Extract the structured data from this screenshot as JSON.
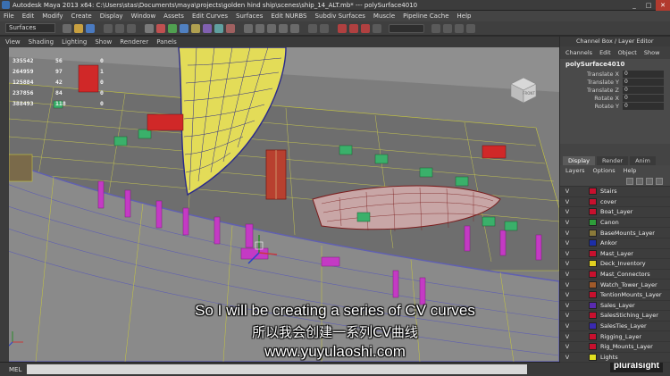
{
  "window": {
    "title": "Autodesk Maya 2013 x64: C:\\Users\\stas\\Documents\\maya\\projects\\golden hind ship\\scenes\\ship_14_ALT.mb* --- polySurface4010",
    "controls": [
      "_",
      "□",
      "✕"
    ]
  },
  "menubar": [
    "File",
    "Edit",
    "Modify",
    "Create",
    "Display",
    "Window",
    "Assets",
    "Edit Curves",
    "Surfaces",
    "Edit NURBS",
    "Subdiv Surfaces",
    "Muscle",
    "Pipeline Cache",
    "Help"
  ],
  "statusline": {
    "menu_set": "Surfaces"
  },
  "panel_menu": [
    "View",
    "Shading",
    "Lighting",
    "Show",
    "Renderer",
    "Panels"
  ],
  "heads_up": [
    [
      "335542",
      "56",
      "0"
    ],
    [
      "264959",
      "97",
      "1"
    ],
    [
      "125884",
      "42",
      "0"
    ],
    [
      "237856",
      "84",
      "0"
    ],
    [
      "388493",
      "118",
      "0"
    ]
  ],
  "viewcube": {
    "label": "FRONT"
  },
  "subtitles": {
    "english": "So I will be creating a series of CV curves",
    "chinese": "所以我会创建一系列CV曲线",
    "url": "www.yuyulaoshi.com"
  },
  "command_line": {
    "label": "MEL"
  },
  "brand": "pluralsight",
  "channel_box": {
    "header": "Channel Box / Layer Editor",
    "menu": [
      "Channels",
      "Edit",
      "Object",
      "Show"
    ],
    "node": "polySurface4010",
    "attributes": [
      {
        "label": "Translate X",
        "value": "0"
      },
      {
        "label": "Translate Y",
        "value": "0"
      },
      {
        "label": "Translate Z",
        "value": "0"
      },
      {
        "label": "Rotate X",
        "value": "0"
      },
      {
        "label": "Rotate Y",
        "value": "0"
      }
    ]
  },
  "layer_editor": {
    "tabs": [
      "Display",
      "Render",
      "Anim"
    ],
    "menu": [
      "Layers",
      "Options",
      "Help"
    ],
    "layers": [
      {
        "v": "V",
        "name": "Stairs",
        "color": "#c8102e"
      },
      {
        "v": "V",
        "name": "cover",
        "color": "#c8102e"
      },
      {
        "v": "V",
        "name": "Boat_Layer",
        "color": "#c8102e"
      },
      {
        "v": "V",
        "name": "Canon",
        "color": "#2e9e3a"
      },
      {
        "v": "V",
        "name": "BaseMounts_Layer",
        "color": "#8a7a3a"
      },
      {
        "v": "V",
        "name": "Ankor",
        "color": "#1c2ea8"
      },
      {
        "v": "V",
        "name": "Mast_Layer",
        "color": "#c8102e"
      },
      {
        "v": "V",
        "name": "Deck_Inventory",
        "color": "#e0d020"
      },
      {
        "v": "V",
        "name": "Mast_Connectors",
        "color": "#c8102e"
      },
      {
        "v": "V",
        "name": "Watch_Tower_Layer",
        "color": "#a05a2a"
      },
      {
        "v": "V",
        "name": "TentionMounts_Layer",
        "color": "#c8102e"
      },
      {
        "v": "V",
        "name": "Sales_Layer",
        "color": "#5a2ab0"
      },
      {
        "v": "V",
        "name": "SalesStiching_Layer",
        "color": "#c8102e"
      },
      {
        "v": "V",
        "name": "SalesTies_Layer",
        "color": "#3a2ab0"
      },
      {
        "v": "V",
        "name": "Rigging_Layer",
        "color": "#c8102e"
      },
      {
        "v": "V",
        "name": "Rig_Mounts_Layer",
        "color": "#c8102e"
      },
      {
        "v": "V",
        "name": "Lights",
        "color": "#e0e020"
      }
    ]
  }
}
